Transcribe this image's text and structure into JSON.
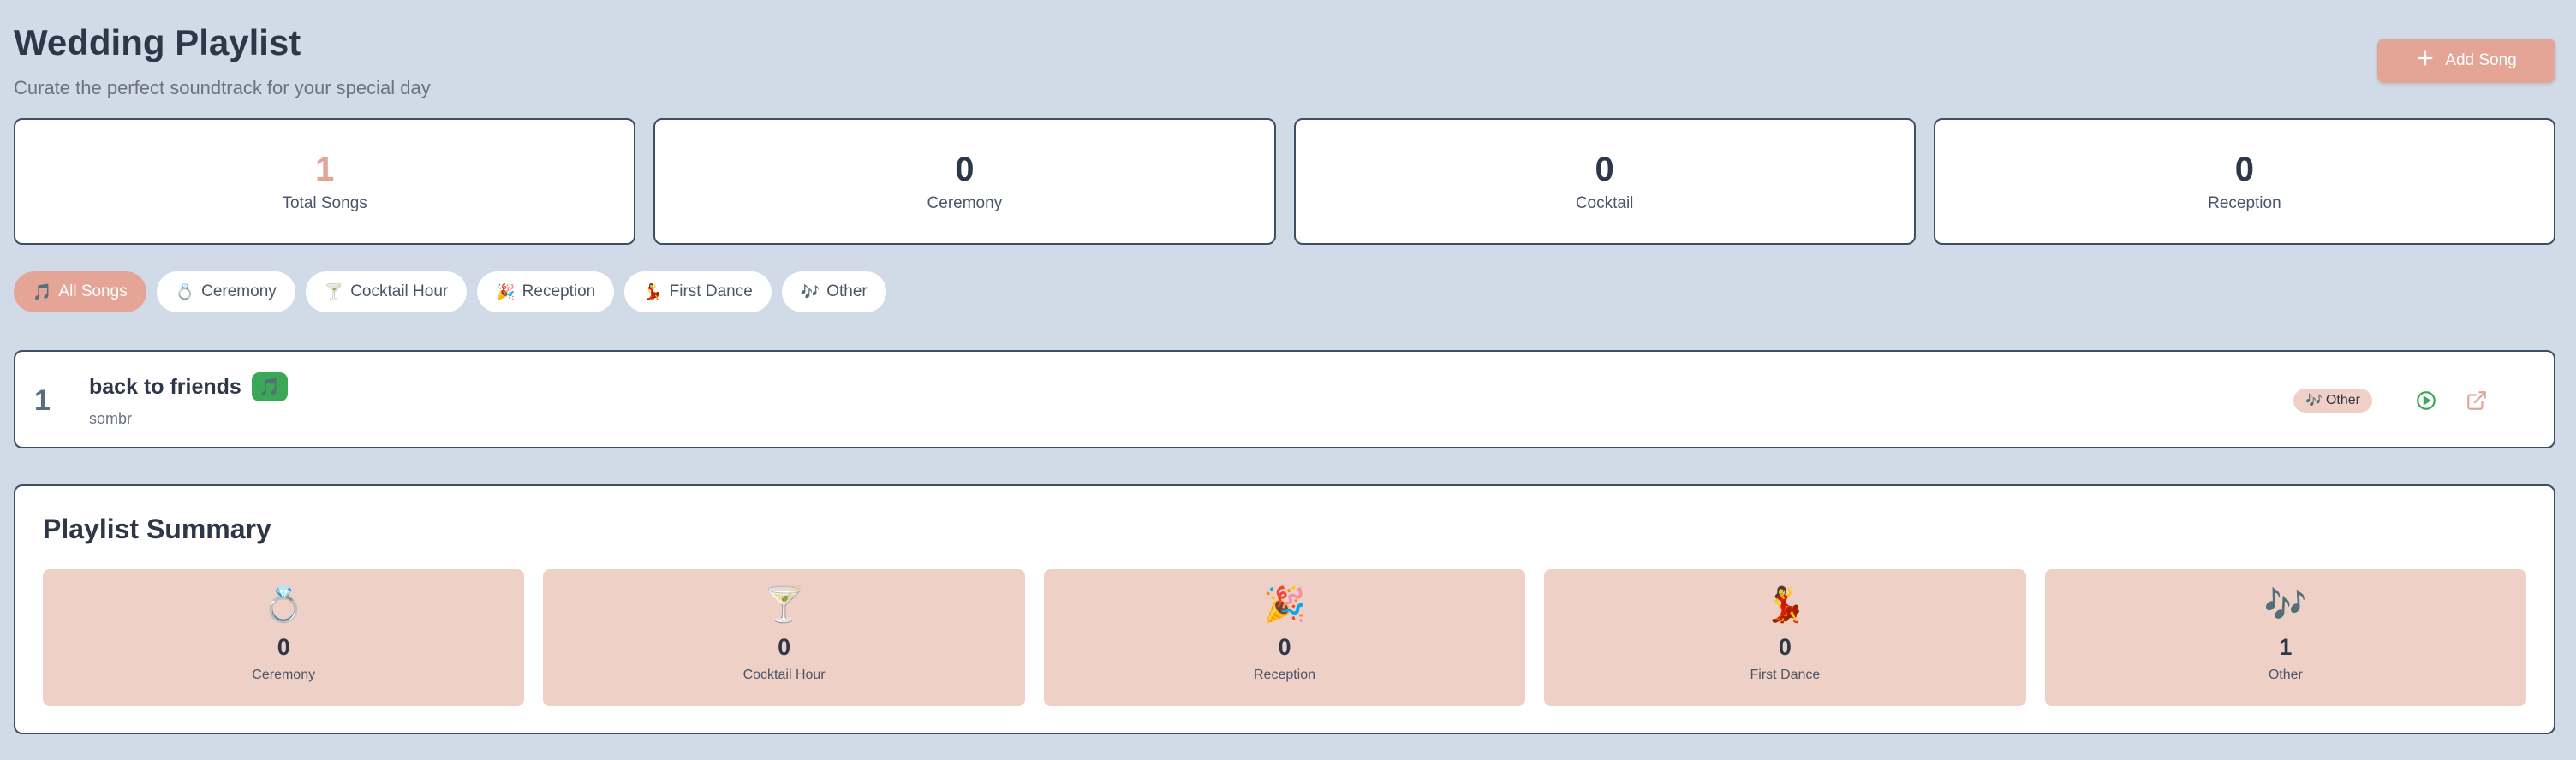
{
  "header": {
    "title": "Wedding Playlist",
    "subtitle": "Curate the perfect soundtrack for your special day",
    "add_button_label": "Add Song"
  },
  "stats": [
    {
      "value": "1",
      "label": "Total Songs"
    },
    {
      "value": "0",
      "label": "Ceremony"
    },
    {
      "value": "0",
      "label": "Cocktail"
    },
    {
      "value": "0",
      "label": "Reception"
    }
  ],
  "filters": [
    {
      "icon": "🎵",
      "label": "All Songs",
      "active": true
    },
    {
      "icon": "💍",
      "label": "Ceremony"
    },
    {
      "icon": "🍸",
      "label": "Cocktail Hour"
    },
    {
      "icon": "🎉",
      "label": "Reception"
    },
    {
      "icon": "💃",
      "label": "First Dance"
    },
    {
      "icon": "🎶",
      "label": "Other"
    }
  ],
  "songs": [
    {
      "number": "1",
      "title": "back to friends",
      "badge_icon": "🎵",
      "artist": "sombr",
      "category_icon": "🎶",
      "category": "Other"
    }
  ],
  "summary": {
    "title": "Playlist Summary",
    "items": [
      {
        "emoji": "💍",
        "count": "0",
        "label": "Ceremony"
      },
      {
        "emoji": "🍸",
        "count": "0",
        "label": "Cocktail Hour"
      },
      {
        "emoji": "🎉",
        "count": "0",
        "label": "Reception"
      },
      {
        "emoji": "💃",
        "count": "0",
        "label": "First Dance"
      },
      {
        "emoji": "🎶",
        "count": "1",
        "label": "Other"
      }
    ]
  },
  "colors": {
    "background": "#d0dbe7",
    "accent": "#e4a597",
    "card_border": "#3d4f66",
    "summary_card": "#efd0c7",
    "play_green": "#3aa856"
  },
  "icons": {
    "add": "plus-icon",
    "play": "play-circle-icon",
    "open": "external-link-icon"
  }
}
